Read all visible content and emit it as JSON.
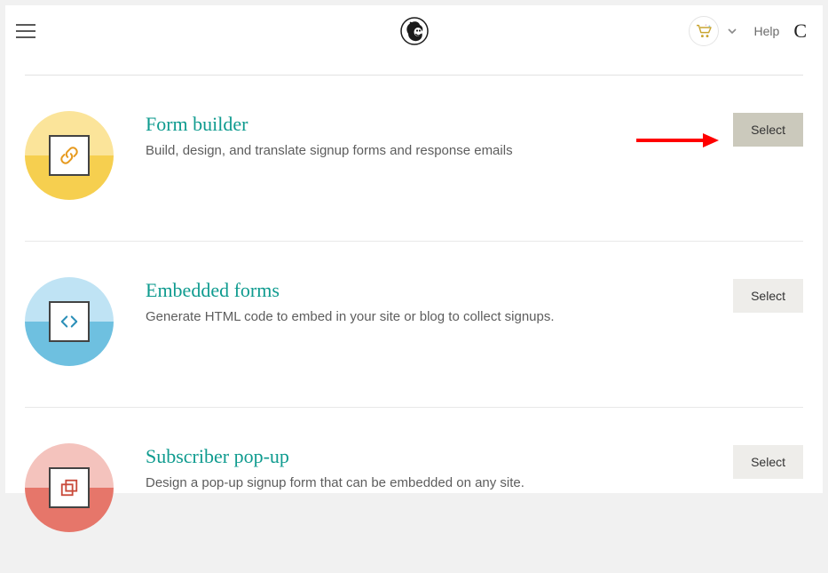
{
  "header": {
    "help_label": "Help"
  },
  "items": [
    {
      "title": "Form builder",
      "desc": "Build, design, and translate signup forms and response emails",
      "select_label": "Select"
    },
    {
      "title": "Embedded forms",
      "desc": "Generate HTML code to embed in your site or blog to collect signups.",
      "select_label": "Select"
    },
    {
      "title": "Subscriber pop-up",
      "desc": "Design a pop-up signup form that can be embedded on any site.",
      "select_label": "Select"
    }
  ]
}
